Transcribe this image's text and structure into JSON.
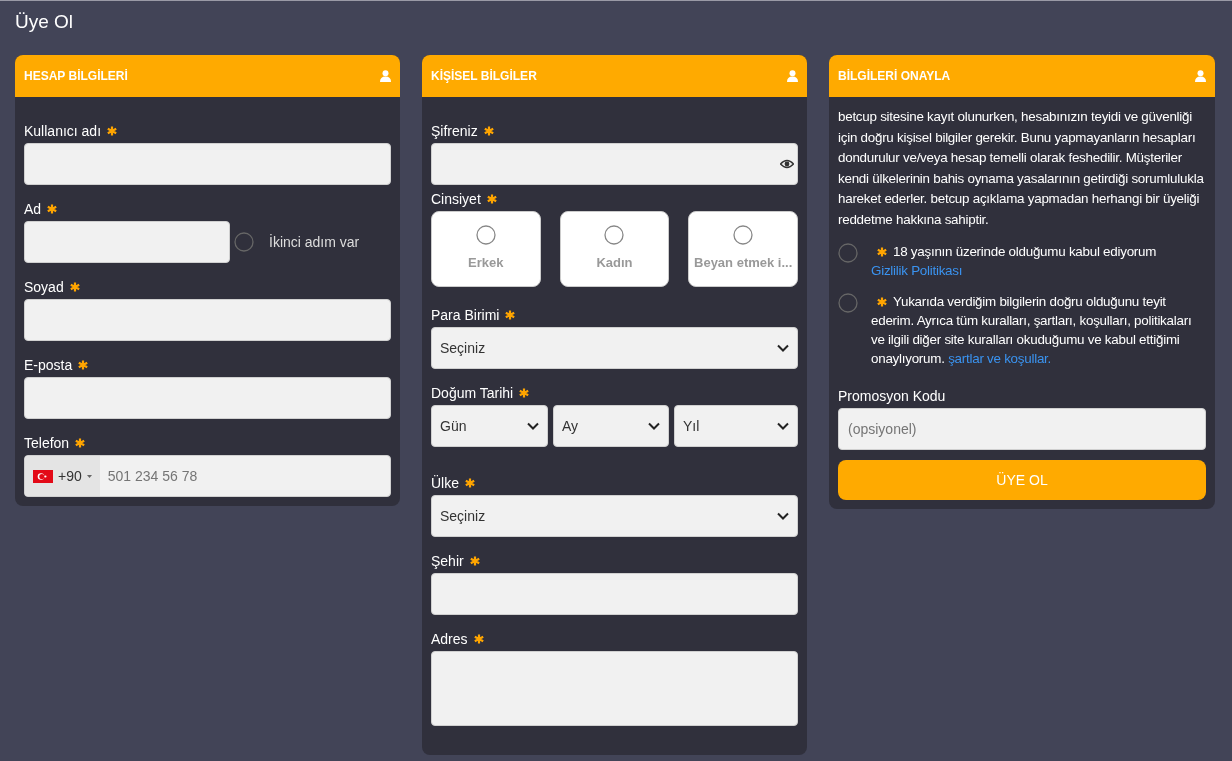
{
  "page_title": "Üye Ol",
  "cards": [
    {
      "title": "HESAP BİLGİLERİ",
      "fields": [
        {
          "kind": "text",
          "label": "Kullanıcı adı",
          "required": true
        },
        {
          "kind": "text_option",
          "label": "Ad",
          "required": true,
          "option": {
            "label": "İkinci adım var",
            "checked": false
          }
        },
        {
          "kind": "text",
          "label": "Soyad",
          "required": true
        },
        {
          "kind": "text",
          "label": "E-posta",
          "required": true
        },
        {
          "kind": "phone",
          "label": "Telefon",
          "required": true,
          "country_code": "+90",
          "placeholder": "501 234 56 78"
        }
      ]
    },
    {
      "title": "KİŞİSEL BİLGİLER",
      "fields": [
        {
          "kind": "password",
          "label": "Şifreniz",
          "required": true
        },
        {
          "kind": "choice",
          "label": "Cinsiyet",
          "required": true,
          "options": [
            {
              "label": "Erkek",
              "selected": false
            },
            {
              "label": "Kadın",
              "selected": false
            },
            {
              "label": "Beyan etmek i...",
              "selected": false
            }
          ]
        },
        {
          "kind": "select",
          "label": "Para Birimi",
          "required": true,
          "value": "Seçiniz"
        },
        {
          "kind": "date",
          "label": "Doğum Tarihi",
          "required": true,
          "parts": [
            "Gün",
            "Ay",
            "Yıl"
          ]
        },
        {
          "kind": "select",
          "label": "Ülke",
          "required": true,
          "value": "Seçiniz"
        },
        {
          "kind": "text",
          "label": "Şehir",
          "required": true
        },
        {
          "kind": "textarea",
          "label": "Adres",
          "required": true
        }
      ]
    },
    {
      "title": "BİLGİLERİ ONAYLA",
      "fields": [
        {
          "kind": "paragraph",
          "text": "betcup sitesine kayıt olunurken, hesabınızın teyidi ve güvenliği için doğru kişisel bilgiler gerekir. Bunu yapmayanların hesapları dondurulur ve/veya hesap temelli olarak feshedilir. Müşteriler kendi ülkelerinin bahis oynama yasalarının getirdiği sorumlulukla hareket ederler. betcup açıklama yapmadan herhangi bir üyeliği reddetme hakkına sahiptir."
        },
        {
          "kind": "agreement",
          "text": "18 yaşının üzerinde olduğumu kabul ediyorum",
          "link": "Gizlilik Politikası",
          "required": true,
          "checked": false
        },
        {
          "kind": "agreement",
          "text": "Yukarıda verdiğim bilgilerin doğru olduğunu teyit ederim. Ayrıca tüm kuralları, şartları, koşulları, politikaları ve ilgili diğer site kuralları okuduğumu ve kabul ettiğimi onaylıyorum.",
          "link": "şartlar ve koşullar.",
          "required": true,
          "checked": false
        },
        {
          "kind": "text",
          "label": "Promosyon Kodu",
          "placeholder": "(opsiyonel)"
        },
        {
          "kind": "button",
          "label": "ÜYE OL"
        }
      ]
    }
  ]
}
